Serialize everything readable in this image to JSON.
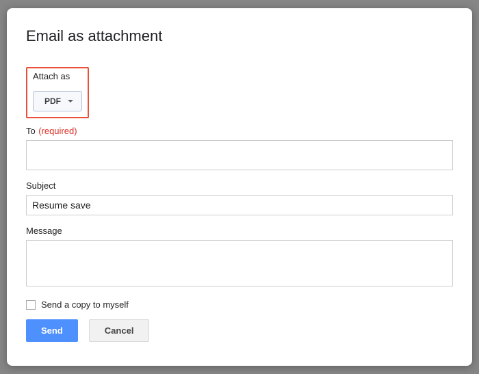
{
  "dialog": {
    "title": "Email as attachment",
    "attach_as": {
      "label": "Attach as",
      "selected": "PDF"
    },
    "to": {
      "label": "To",
      "required": "(required)",
      "value": ""
    },
    "subject": {
      "label": "Subject",
      "value": "Resume save"
    },
    "message": {
      "label": "Message",
      "value": ""
    },
    "copy_self": {
      "label": "Send a copy to myself",
      "checked": false
    },
    "buttons": {
      "send": "Send",
      "cancel": "Cancel"
    }
  }
}
